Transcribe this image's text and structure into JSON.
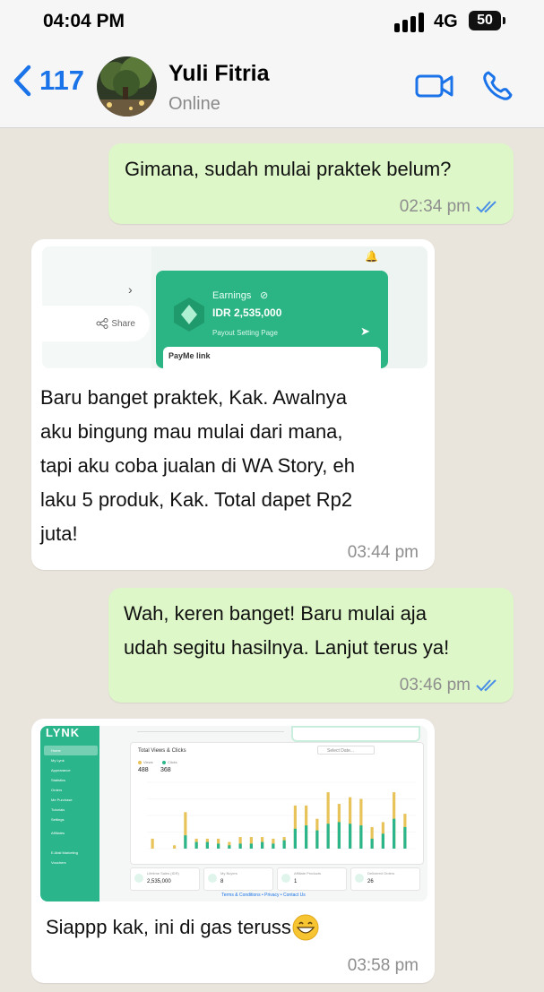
{
  "status_bar": {
    "time": "04:04 PM",
    "network": "4G",
    "battery": "50"
  },
  "header": {
    "back_count": "117",
    "contact_name": "Yuli Fitria",
    "contact_status": "Online"
  },
  "messages": [
    {
      "text": "Gimana, sudah mulai praktek belum?",
      "time": "02:34 pm"
    },
    {
      "lines": [
        "Baru banget praktek, Kak. Awalnya",
        "aku bingung mau mulai dari mana,",
        "tapi aku coba jualan di WA Story, eh",
        "laku 5 produk, Kak. Total dapet Rp2",
        "juta!"
      ],
      "time": "03:44 pm"
    },
    {
      "lines": [
        "Wah, keren banget! Baru mulai aja",
        "udah segitu hasilnya. Lanjut terus ya!"
      ],
      "time": "03:46 pm"
    },
    {
      "text": "Siappp kak, ini di gas teruss",
      "time": "03:58 pm"
    }
  ],
  "earnings_card": {
    "title": "Earnings",
    "amount": "IDR 2,535,000",
    "payout": "Payout Setting Page",
    "payme": "PayMe link",
    "share": "Share"
  },
  "dashboard": {
    "logo": "LYNK",
    "menu": [
      "Home",
      "My Lynk",
      "Appearance",
      "Statistics",
      "Orders",
      "Me Purchase",
      "Tutorials",
      "Settings",
      "Affiliates",
      "E-Mail Marketing",
      "Vouchers"
    ],
    "chart_title": "Total Views & Clicks",
    "views": "488",
    "clicks": "368",
    "views_label": "Views",
    "clicks_label": "Clicks",
    "select_date": "Select Date...",
    "stats": [
      {
        "label": "Lifetime Sales (IDR)",
        "value": "2,535,000"
      },
      {
        "label": "My Buyers",
        "value": "8"
      },
      {
        "label": "Affiliate Products",
        "value": "1"
      },
      {
        "label": "Delivered Orders",
        "value": "26"
      }
    ],
    "footer": "Terms & Conditions • Privacy • Contact Us",
    "series_colors": {
      "views": "#e8c35a",
      "clicks": "#2bb58a"
    }
  },
  "chart_data": {
    "type": "bar",
    "title": "Total Views & Clicks",
    "series": [
      {
        "name": "Views",
        "values": [
          6,
          0,
          2,
          22,
          6,
          6,
          6,
          4,
          7,
          7,
          7,
          6,
          7,
          26,
          26,
          18,
          34,
          27,
          31,
          30,
          13,
          16,
          34,
          21
        ]
      },
      {
        "name": "Clicks",
        "values": [
          0,
          0,
          0,
          8,
          4,
          4,
          3,
          2,
          3,
          3,
          4,
          3,
          5,
          12,
          14,
          11,
          15,
          16,
          15,
          14,
          6,
          9,
          18,
          13
        ]
      }
    ]
  }
}
